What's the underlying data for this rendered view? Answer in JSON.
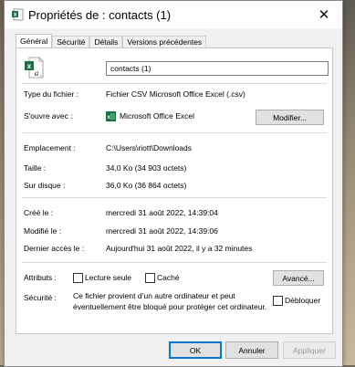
{
  "window": {
    "title": "Propriétés de : contacts (1)",
    "close_glyph": "✕"
  },
  "tabs": [
    {
      "label": "Général",
      "active": true
    },
    {
      "label": "Sécurité",
      "active": false
    },
    {
      "label": "Détails",
      "active": false
    },
    {
      "label": "Versions précédentes",
      "active": false
    }
  ],
  "general": {
    "file_name": "contacts (1)",
    "file_type_label": "Type du fichier :",
    "file_type_value": "Fichier CSV Microsoft Office Excel (.csv)",
    "opens_with_label": "S'ouvre avec :",
    "opens_with_value": "Microsoft Office Excel",
    "change_button": "Modifier...",
    "location_label": "Emplacement :",
    "location_value": "C:\\Users\\riott\\Downloads",
    "size_label": "Taille :",
    "size_value": "34,0 Ko (34 903 octets)",
    "disk_size_label": "Sur disque :",
    "disk_size_value": "36,0 Ko (36 864 octets)",
    "created_label": "Créé le :",
    "created_value": "mercredi 31 août 2022, 14:39:04",
    "modified_label": "Modifié le :",
    "modified_value": "mercredi 31 août 2022, 14:39:06",
    "accessed_label": "Dernier accès le :",
    "accessed_value": "Aujourd'hui 31 août 2022, il y a 32 minutes",
    "attributes_label": "Attributs :",
    "readonly_label": "Lecture seule",
    "readonly_checked": false,
    "hidden_label": "Caché",
    "hidden_checked": false,
    "advanced_button": "Avancé...",
    "security_label": "Sécurité :",
    "security_text": "Ce fichier provient d’un autre ordinateur et peut éventuellement être bloqué pour protéger cet ordinateur.",
    "unblock_label": "Débloquer",
    "unblock_checked": false
  },
  "footer": {
    "ok": "OK",
    "cancel": "Annuler",
    "apply": "Appliquer"
  },
  "icons": {
    "title_icon": "excel-csv-file-icon",
    "file_icon": "excel-csv-file-icon",
    "app_icon": "excel-app-icon"
  },
  "colors": {
    "excel_green": "#1e7145",
    "focus_blue": "#0078d7"
  }
}
